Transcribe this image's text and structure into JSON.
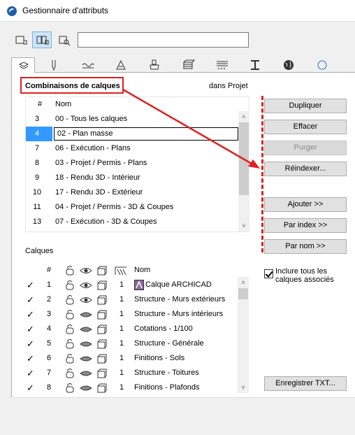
{
  "window": {
    "title": "Gestionnaire d'attributs"
  },
  "toolbar": {
    "view_buttons": [
      "list-view-icon",
      "split-view-icon",
      "detail-view-icon"
    ],
    "search_value": ""
  },
  "tabs": [
    {
      "icon": "layers-icon"
    },
    {
      "icon": "pen-icon"
    },
    {
      "icon": "line-types-icon"
    },
    {
      "icon": "fill-icon"
    },
    {
      "icon": "paint-bucket-icon"
    },
    {
      "icon": "composite-icon"
    },
    {
      "icon": "profile-hatch-icon"
    },
    {
      "icon": "beam-profile-icon"
    },
    {
      "icon": "globe-icon"
    }
  ],
  "combinations": {
    "title": "Combinaisons de calques",
    "scope": "dans Projet",
    "headers": {
      "num": "#",
      "name": "Nom"
    },
    "rows": [
      {
        "num": "3",
        "name": "00 - Tous les calques"
      },
      {
        "num": "4",
        "name": "02 - Plan masse"
      },
      {
        "num": "7",
        "name": "06 - Exécution - Plans"
      },
      {
        "num": "8",
        "name": "03 - Projet / Permis - Plans"
      },
      {
        "num": "9",
        "name": "18 - Rendu 3D - Intérieur"
      },
      {
        "num": "10",
        "name": "17 - Rendu 3D - Extérieur"
      },
      {
        "num": "11",
        "name": "04 - Projet / Permis - 3D & Coupes"
      },
      {
        "num": "13",
        "name": "07 - Exécution - 3D & Coupes"
      }
    ],
    "selected_index": 1
  },
  "buttons": {
    "dupliquer": "Dupliquer",
    "effacer": "Effacer",
    "purger": "Purger",
    "reindexer": "Réindexer...",
    "ajouter": "Ajouter >>",
    "par_index": "Par index >>",
    "par_nom": "Par nom >>",
    "enregistrer": "Enregistrer TXT..."
  },
  "layers": {
    "title": "Calques",
    "headers": {
      "num": "#",
      "name": "Nom"
    },
    "rows": [
      {
        "checked": true,
        "num": "1",
        "visible": true,
        "pen": "1",
        "name": "Calque ARCHICAD"
      },
      {
        "checked": true,
        "num": "2",
        "visible": true,
        "pen": "1",
        "name": "Structure - Murs extérieurs"
      },
      {
        "checked": true,
        "num": "3",
        "visible": false,
        "pen": "1",
        "name": "Structure - Murs intérieurs"
      },
      {
        "checked": true,
        "num": "4",
        "visible": false,
        "pen": "1",
        "name": "Cotations - 1/100"
      },
      {
        "checked": true,
        "num": "5",
        "visible": false,
        "pen": "1",
        "name": "Structure - Générale"
      },
      {
        "checked": true,
        "num": "6",
        "visible": false,
        "pen": "1",
        "name": "Finitions - Sols"
      },
      {
        "checked": true,
        "num": "7",
        "visible": false,
        "pen": "1",
        "name": "Structure - Toitures"
      },
      {
        "checked": true,
        "num": "8",
        "visible": false,
        "pen": "1",
        "name": "Finitions - Plafonds"
      }
    ]
  },
  "include_all": {
    "label": "Inclure tous les calques associés",
    "checked": true
  },
  "colors": {
    "annotation": "#e02020",
    "selection": "#3399ff"
  }
}
